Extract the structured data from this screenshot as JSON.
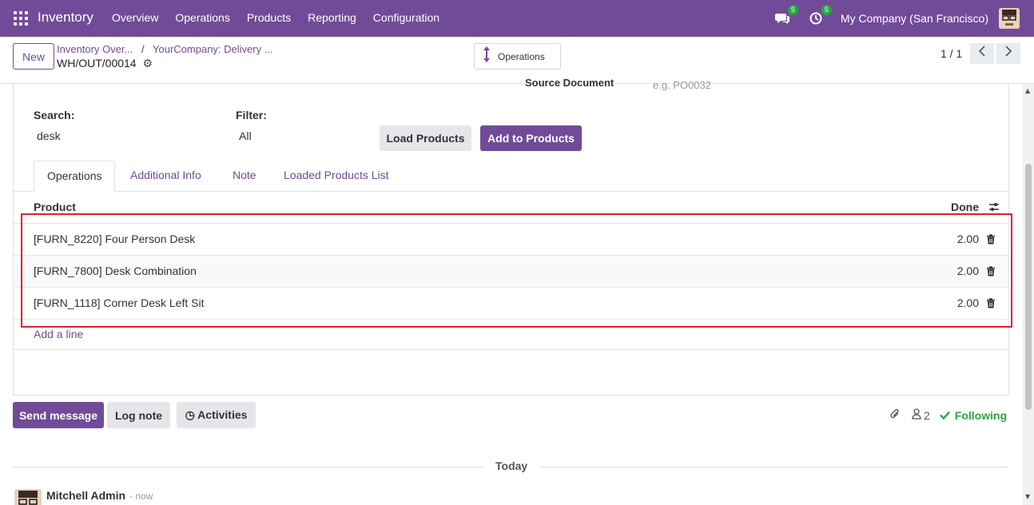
{
  "navbar": {
    "app_name": "Inventory",
    "menu": [
      "Overview",
      "Operations",
      "Products",
      "Reporting",
      "Configuration"
    ],
    "messages_count": "5",
    "activities_count": "5",
    "company": "My Company (San Francisco)"
  },
  "control": {
    "new_label": "New",
    "breadcrumb_1": "Inventory Over...",
    "breadcrumb_2": "YourCompany: Delivery ...",
    "record_name": "WH/OUT/00014",
    "smart_button": "Operations",
    "pager": "1 / 1"
  },
  "form": {
    "source_document_label": "Source Document",
    "source_document_placeholder": "e.g. PO0032",
    "search_label": "Search:",
    "search_value": "desk",
    "filter_label": "Filter:",
    "filter_value": "All",
    "load_products": "Load Products",
    "add_to_products": "Add to Products"
  },
  "tabs": [
    "Operations",
    "Additional Info",
    "Note",
    "Loaded Products List"
  ],
  "list": {
    "col_product": "Product",
    "col_done": "Done",
    "rows": [
      {
        "product": "[FURN_8220] Four Person Desk",
        "done": "2.00"
      },
      {
        "product": "[FURN_7800] Desk Combination",
        "done": "2.00"
      },
      {
        "product": "[FURN_1118] Corner Desk Left Sit",
        "done": "2.00"
      }
    ],
    "add_line": "Add a line"
  },
  "chatter": {
    "send_message": "Send message",
    "log_note": "Log note",
    "activities": "Activities",
    "followers_count": "2",
    "following": "Following",
    "today": "Today",
    "author": "Mitchell Admin",
    "time": "- now"
  },
  "colors": {
    "brand": "#714b98",
    "highlight": "#e0202a",
    "success": "#28a745"
  }
}
